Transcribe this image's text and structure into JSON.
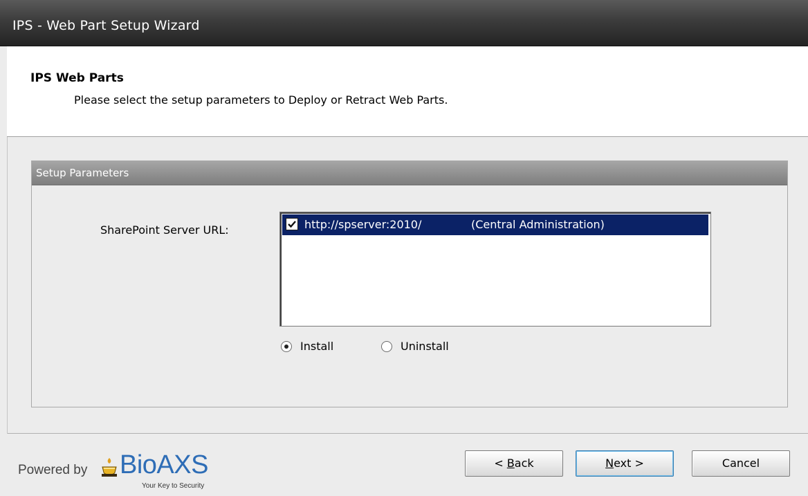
{
  "window": {
    "title": "IPS - Web Part Setup Wizard"
  },
  "header": {
    "title": "IPS Web Parts",
    "subtitle": "Please select the setup parameters to Deploy or Retract Web Parts."
  },
  "setup_group": {
    "title": "Setup Parameters",
    "url_label": "SharePoint Server URL:",
    "servers": [
      {
        "checked": true,
        "url": "http://spserver:2010/",
        "description": "(Central Administration)",
        "selected": true
      }
    ],
    "actions": [
      {
        "label": "Install",
        "selected": true
      },
      {
        "label": "Uninstall",
        "selected": false
      }
    ]
  },
  "footer": {
    "powered_by": "Powered by",
    "logo_brand": "BioAXS",
    "logo_tagline": "Your Key to Security",
    "buttons": {
      "back": {
        "prefix": "< ",
        "mnemonic": "B",
        "rest": "ack"
      },
      "next": {
        "mnemonic": "N",
        "rest": "ext >"
      },
      "cancel": "Cancel"
    }
  },
  "colors": {
    "selection": "#0b2266",
    "group_header": "#8e8e8e",
    "brand_blue": "#2e6db6"
  }
}
